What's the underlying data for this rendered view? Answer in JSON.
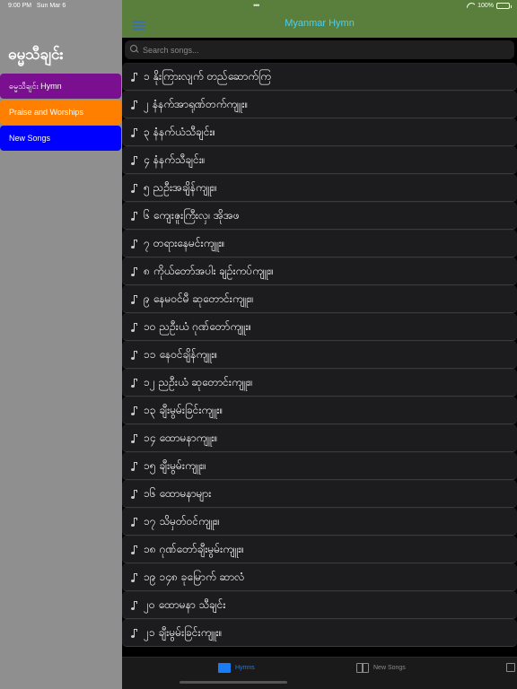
{
  "status_bar": {
    "time": "9:00 PM",
    "date": "Sun Mar 6",
    "battery": "100%"
  },
  "sidebar": {
    "title": "ဓမ္မသီချင်း",
    "items": [
      {
        "label": "ဓမ္မသီချင်း Hymn",
        "color": "#7a0f8f"
      },
      {
        "label": "Praise and Worships",
        "color": "#ff7f00"
      },
      {
        "label": "New Songs",
        "color": "#0000ff"
      }
    ]
  },
  "header": {
    "title": "Myanmar Hymn",
    "menu_icon": "hamburger-menu-icon"
  },
  "search": {
    "placeholder": "Search songs..."
  },
  "songs": [
    {
      "num": "၁",
      "title": "နိုးကြားလျက် တည်ဆောက်ကြ"
    },
    {
      "num": "၂",
      "title": "နံနက်အာရုဏ်တက်ကျူး။"
    },
    {
      "num": "၃",
      "title": "နံနက်ယံသီချင်း။"
    },
    {
      "num": "၄",
      "title": "နံနက်သီချင်း။"
    },
    {
      "num": "၅",
      "title": "ညဦးအချိန်ကျူး။"
    },
    {
      "num": "၆",
      "title": "ကျေးဇူးကြီးလှ၊ အိုအဖ"
    },
    {
      "num": "၇",
      "title": "တရားနေမင်းကျူး။"
    },
    {
      "num": "၈",
      "title": "ကိုယ်တော်အပါး ချဉ်းကပ်ကျူး။"
    },
    {
      "num": "၉",
      "title": "နေမဝင်မီ ဆုတောင်းကျူး။"
    },
    {
      "num": "၁၀",
      "title": "ညဦးယံ ဂုဏ်တော်ကျူး။"
    },
    {
      "num": "၁၁",
      "title": "နေဝင်ချိန်ကျူး။"
    },
    {
      "num": "၁၂",
      "title": "ညဦးယံ ဆုတောင်းကျူး။"
    },
    {
      "num": "၁၃",
      "title": "ချီးမွမ်းခြင်းကျူး။"
    },
    {
      "num": "၁၄",
      "title": "ထောမနာကျူး။"
    },
    {
      "num": "၁၅",
      "title": "ချီးမွမ်းကျူး။"
    },
    {
      "num": "၁၆",
      "title": "ထောမနာများ"
    },
    {
      "num": "၁၇",
      "title": "သိမှတ်ဝင်ကျူး။"
    },
    {
      "num": "၁၈",
      "title": "ဂုဏ်တော်ချီးမွမ်းကျူး။"
    },
    {
      "num": "၁၉",
      "title": "၁၄၈ ခုမြောက် ဆာလံ"
    },
    {
      "num": "၂၀",
      "title": "ထောမနာ သီချင်း"
    },
    {
      "num": "၂၁",
      "title": "ချီးမွမ်းခြင်းကျူး။"
    }
  ],
  "tabs": [
    {
      "label": "Hymns",
      "icon": "book-icon",
      "active": true
    },
    {
      "label": "New Songs",
      "icon": "book-icon",
      "active": false
    },
    {
      "label": "",
      "icon": "list-icon",
      "active": false
    }
  ]
}
